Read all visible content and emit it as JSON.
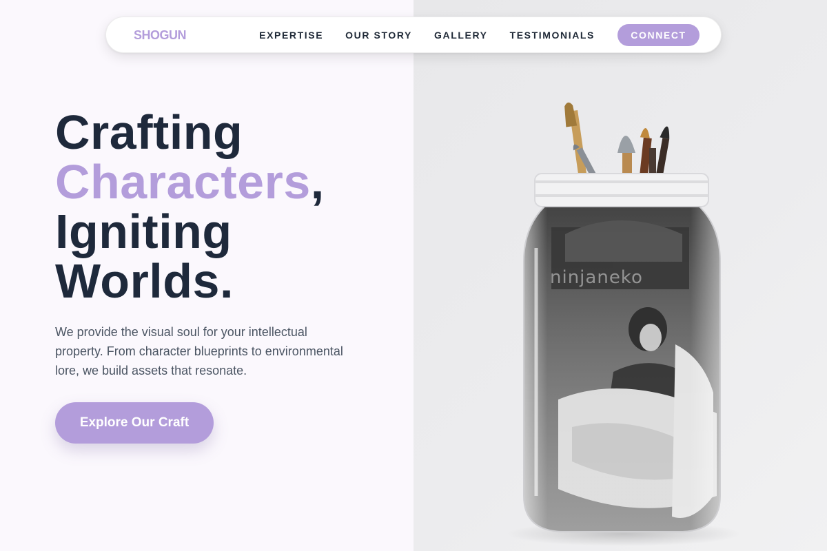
{
  "nav": {
    "logo": "SHOGUN",
    "links": [
      "EXPERTISE",
      "OUR STORY",
      "GALLERY",
      "TESTIMONIALS"
    ],
    "cta": "CONNECT"
  },
  "hero": {
    "title_line1": "Crafting",
    "title_accent": "Characters",
    "title_comma": ",",
    "title_line3": "Igniting",
    "title_line4": "Worlds.",
    "description": "We provide the visual soul for your intellectual property. From character blueprints to environmental lore, we build assets that resonate.",
    "cta": "Explore Our Craft"
  },
  "image": {
    "watermark": "ninjaneko"
  },
  "colors": {
    "accent": "#b39ddb",
    "heading": "#1e293b",
    "body_text": "#4b5563"
  }
}
